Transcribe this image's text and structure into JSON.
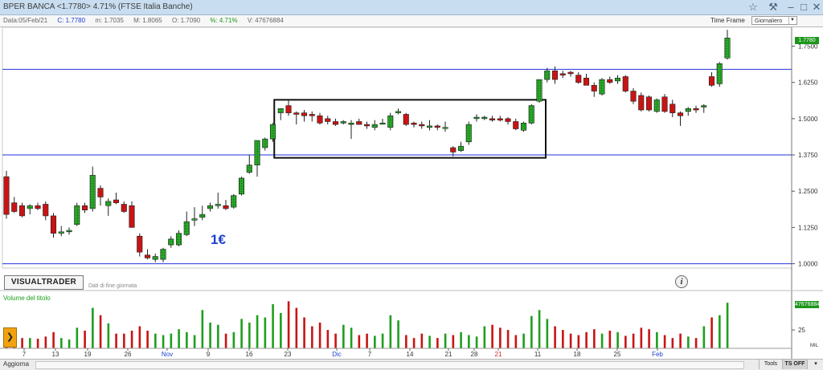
{
  "header": {
    "title": "BPER BANCA  <1.7780>  4.71%    (FTSE Italia Banche)",
    "icons": [
      "star-icon",
      "hammer-icon",
      "minimize-icon",
      "restore-icon",
      "close-icon"
    ]
  },
  "ohlc": {
    "data": "Data:05/Feb/21",
    "c": "C: 1.7780",
    "m": "m: 1.7035",
    "M": "M: 1.8065",
    "o": "O: 1.7090",
    "pct": "%: 4.71%",
    "vol": "V: 47676884"
  },
  "timeframe": {
    "label": "Time Frame",
    "value": "Giornaliero"
  },
  "branding": {
    "logo": "VISUALTRADER",
    "subtitle": "Dati di fine giornata"
  },
  "annotation": "1€",
  "volume_panel": {
    "label": "Volume del titolo",
    "axis_label": "25",
    "unit": "MIL",
    "last_badge": "47676884"
  },
  "price_badge": "1.7780",
  "footer": {
    "aggiorna": "Aggiorna",
    "tools": "Tools",
    "ts_off": "TS OFF"
  },
  "colors": {
    "up": "#1f9e1f",
    "down": "#c81414",
    "level_line": "#2233dd",
    "box": "#111111",
    "month_label": "#1c3fcf",
    "year_label": "#cc2222"
  },
  "chart_data": {
    "type": "candlestick",
    "title": "BPER BANCA",
    "y_axis": {
      "ticks": [
        1.0,
        1.125,
        1.25,
        1.375,
        1.5,
        1.625,
        1.75
      ],
      "tick_labels": [
        "1.0000",
        "1.1250",
        "1.2500",
        "1.3750",
        "1.5000",
        "1.6250",
        "1.7500"
      ],
      "range": [
        0.985,
        1.815
      ]
    },
    "x_labels": [
      "7",
      "13",
      "19",
      "26",
      "Nov",
      "9",
      "16",
      "23",
      "Dic",
      "7",
      "14",
      "21",
      "28",
      "21",
      "11",
      "18",
      "25",
      "Feb"
    ],
    "x_label_types": [
      "day",
      "day",
      "day",
      "day",
      "month",
      "day",
      "day",
      "day",
      "month",
      "day",
      "day",
      "day",
      "day",
      "year",
      "day",
      "day",
      "day",
      "month"
    ],
    "horizontal_levels": [
      1.67,
      1.375,
      1.0
    ],
    "box": {
      "x_from_index": 35,
      "x_to_index": 68,
      "y_low": 1.365,
      "y_high": 1.565
    },
    "volume_ticks": [
      {
        "value": 25,
        "label": "25"
      }
    ],
    "volume_range": [
      0,
      72
    ],
    "candles": [
      {
        "o": 1.3,
        "h": 1.32,
        "l": 1.155,
        "c": 1.17,
        "v": 18
      },
      {
        "o": 1.21,
        "h": 1.23,
        "l": 1.175,
        "c": 1.18,
        "v": 10
      },
      {
        "o": 1.2,
        "h": 1.21,
        "l": 1.16,
        "c": 1.165,
        "v": 14
      },
      {
        "o": 1.19,
        "h": 1.205,
        "l": 1.17,
        "c": 1.2,
        "v": 14
      },
      {
        "o": 1.2,
        "h": 1.21,
        "l": 1.185,
        "c": 1.19,
        "v": 13
      },
      {
        "o": 1.205,
        "h": 1.215,
        "l": 1.15,
        "c": 1.165,
        "v": 16
      },
      {
        "o": 1.165,
        "h": 1.175,
        "l": 1.09,
        "c": 1.105,
        "v": 22
      },
      {
        "o": 1.105,
        "h": 1.13,
        "l": 1.095,
        "c": 1.11,
        "v": 14
      },
      {
        "o": 1.11,
        "h": 1.125,
        "l": 1.1,
        "c": 1.115,
        "v": 12
      },
      {
        "o": 1.135,
        "h": 1.21,
        "l": 1.13,
        "c": 1.2,
        "v": 28
      },
      {
        "o": 1.2,
        "h": 1.21,
        "l": 1.175,
        "c": 1.185,
        "v": 24
      },
      {
        "o": 1.19,
        "h": 1.335,
        "l": 1.18,
        "c": 1.305,
        "v": 55
      },
      {
        "o": 1.26,
        "h": 1.27,
        "l": 1.2,
        "c": 1.23,
        "v": 45
      },
      {
        "o": 1.2,
        "h": 1.225,
        "l": 1.165,
        "c": 1.215,
        "v": 34
      },
      {
        "o": 1.22,
        "h": 1.245,
        "l": 1.205,
        "c": 1.21,
        "v": 20
      },
      {
        "o": 1.205,
        "h": 1.215,
        "l": 1.175,
        "c": 1.18,
        "v": 20
      },
      {
        "o": 1.2,
        "h": 1.215,
        "l": 1.15,
        "c": 1.125,
        "v": 24
      },
      {
        "o": 1.095,
        "h": 1.105,
        "l": 1.025,
        "c": 1.04,
        "v": 30
      },
      {
        "o": 1.03,
        "h": 1.05,
        "l": 1.015,
        "c": 1.02,
        "v": 24
      },
      {
        "o": 1.015,
        "h": 1.035,
        "l": 1.005,
        "c": 1.025,
        "v": 20
      },
      {
        "o": 1.015,
        "h": 1.055,
        "l": 1.005,
        "c": 1.05,
        "v": 18
      },
      {
        "o": 1.065,
        "h": 1.095,
        "l": 1.055,
        "c": 1.085,
        "v": 20
      },
      {
        "o": 1.065,
        "h": 1.115,
        "l": 1.06,
        "c": 1.105,
        "v": 26
      },
      {
        "o": 1.1,
        "h": 1.18,
        "l": 1.095,
        "c": 1.145,
        "v": 22
      },
      {
        "o": 1.15,
        "h": 1.195,
        "l": 1.13,
        "c": 1.155,
        "v": 18
      },
      {
        "o": 1.16,
        "h": 1.2,
        "l": 1.15,
        "c": 1.17,
        "v": 52
      },
      {
        "o": 1.19,
        "h": 1.21,
        "l": 1.18,
        "c": 1.2,
        "v": 35
      },
      {
        "o": 1.2,
        "h": 1.245,
        "l": 1.19,
        "c": 1.205,
        "v": 32
      },
      {
        "o": 1.2,
        "h": 1.22,
        "l": 1.185,
        "c": 1.19,
        "v": 20
      },
      {
        "o": 1.195,
        "h": 1.24,
        "l": 1.19,
        "c": 1.235,
        "v": 22
      },
      {
        "o": 1.24,
        "h": 1.3,
        "l": 1.235,
        "c": 1.295,
        "v": 40
      },
      {
        "o": 1.315,
        "h": 1.375,
        "l": 1.31,
        "c": 1.34,
        "v": 35
      },
      {
        "o": 1.34,
        "h": 1.42,
        "l": 1.3,
        "c": 1.425,
        "v": 45
      },
      {
        "o": 1.4,
        "h": 1.435,
        "l": 1.39,
        "c": 1.43,
        "v": 42
      },
      {
        "o": 1.43,
        "h": 1.485,
        "l": 1.42,
        "c": 1.48,
        "v": 60
      },
      {
        "o": 1.52,
        "h": 1.535,
        "l": 1.495,
        "c": 1.535,
        "v": 48
      },
      {
        "o": 1.545,
        "h": 1.565,
        "l": 1.51,
        "c": 1.52,
        "v": 64
      },
      {
        "o": 1.52,
        "h": 1.525,
        "l": 1.48,
        "c": 1.515,
        "v": 55
      },
      {
        "o": 1.52,
        "h": 1.53,
        "l": 1.49,
        "c": 1.51,
        "v": 42
      },
      {
        "o": 1.515,
        "h": 1.525,
        "l": 1.49,
        "c": 1.51,
        "v": 30
      },
      {
        "o": 1.51,
        "h": 1.52,
        "l": 1.48,
        "c": 1.485,
        "v": 35
      },
      {
        "o": 1.5,
        "h": 1.51,
        "l": 1.48,
        "c": 1.49,
        "v": 25
      },
      {
        "o": 1.49,
        "h": 1.5,
        "l": 1.475,
        "c": 1.48,
        "v": 20
      },
      {
        "o": 1.485,
        "h": 1.495,
        "l": 1.48,
        "c": 1.49,
        "v": 32
      },
      {
        "o": 1.48,
        "h": 1.495,
        "l": 1.43,
        "c": 1.485,
        "v": 28
      },
      {
        "o": 1.49,
        "h": 1.5,
        "l": 1.48,
        "c": 1.48,
        "v": 18
      },
      {
        "o": 1.48,
        "h": 1.49,
        "l": 1.465,
        "c": 1.475,
        "v": 20
      },
      {
        "o": 1.47,
        "h": 1.495,
        "l": 1.46,
        "c": 1.48,
        "v": 17
      },
      {
        "o": 1.485,
        "h": 1.5,
        "l": 1.48,
        "c": 1.485,
        "v": 20
      },
      {
        "o": 1.47,
        "h": 1.52,
        "l": 1.46,
        "c": 1.51,
        "v": 45
      },
      {
        "o": 1.52,
        "h": 1.535,
        "l": 1.515,
        "c": 1.525,
        "v": 38
      },
      {
        "o": 1.515,
        "h": 1.52,
        "l": 1.475,
        "c": 1.48,
        "v": 18
      },
      {
        "o": 1.485,
        "h": 1.49,
        "l": 1.47,
        "c": 1.48,
        "v": 14
      },
      {
        "o": 1.48,
        "h": 1.49,
        "l": 1.465,
        "c": 1.475,
        "v": 20
      },
      {
        "o": 1.47,
        "h": 1.495,
        "l": 1.46,
        "c": 1.475,
        "v": 17
      },
      {
        "o": 1.475,
        "h": 1.48,
        "l": 1.46,
        "c": 1.47,
        "v": 14
      },
      {
        "o": 1.47,
        "h": 1.49,
        "l": 1.455,
        "c": 1.47,
        "v": 20
      },
      {
        "o": 1.4,
        "h": 1.405,
        "l": 1.37,
        "c": 1.385,
        "v": 18
      },
      {
        "o": 1.39,
        "h": 1.42,
        "l": 1.385,
        "c": 1.405,
        "v": 22
      },
      {
        "o": 1.42,
        "h": 1.49,
        "l": 1.41,
        "c": 1.48,
        "v": 18
      },
      {
        "o": 1.5,
        "h": 1.515,
        "l": 1.49,
        "c": 1.505,
        "v": 16
      },
      {
        "o": 1.5,
        "h": 1.51,
        "l": 1.495,
        "c": 1.505,
        "v": 30
      },
      {
        "o": 1.5,
        "h": 1.51,
        "l": 1.49,
        "c": 1.495,
        "v": 32
      },
      {
        "o": 1.5,
        "h": 1.51,
        "l": 1.49,
        "c": 1.495,
        "v": 28
      },
      {
        "o": 1.5,
        "h": 1.505,
        "l": 1.48,
        "c": 1.49,
        "v": 25
      },
      {
        "o": 1.49,
        "h": 1.5,
        "l": 1.46,
        "c": 1.465,
        "v": 18
      },
      {
        "o": 1.46,
        "h": 1.49,
        "l": 1.455,
        "c": 1.485,
        "v": 20
      },
      {
        "o": 1.485,
        "h": 1.55,
        "l": 1.48,
        "c": 1.545,
        "v": 44
      },
      {
        "o": 1.56,
        "h": 1.635,
        "l": 1.555,
        "c": 1.635,
        "v": 52
      },
      {
        "o": 1.635,
        "h": 1.675,
        "l": 1.625,
        "c": 1.665,
        "v": 40
      },
      {
        "o": 1.665,
        "h": 1.68,
        "l": 1.62,
        "c": 1.635,
        "v": 30
      },
      {
        "o": 1.655,
        "h": 1.665,
        "l": 1.64,
        "c": 1.65,
        "v": 25
      },
      {
        "o": 1.66,
        "h": 1.665,
        "l": 1.645,
        "c": 1.655,
        "v": 20
      },
      {
        "o": 1.65,
        "h": 1.66,
        "l": 1.62,
        "c": 1.625,
        "v": 18
      },
      {
        "o": 1.64,
        "h": 1.655,
        "l": 1.615,
        "c": 1.615,
        "v": 22
      },
      {
        "o": 1.615,
        "h": 1.625,
        "l": 1.575,
        "c": 1.595,
        "v": 26
      },
      {
        "o": 1.585,
        "h": 1.64,
        "l": 1.58,
        "c": 1.635,
        "v": 20
      },
      {
        "o": 1.635,
        "h": 1.645,
        "l": 1.62,
        "c": 1.625,
        "v": 24
      },
      {
        "o": 1.63,
        "h": 1.65,
        "l": 1.62,
        "c": 1.64,
        "v": 22
      },
      {
        "o": 1.645,
        "h": 1.65,
        "l": 1.59,
        "c": 1.595,
        "v": 17
      },
      {
        "o": 1.595,
        "h": 1.605,
        "l": 1.55,
        "c": 1.56,
        "v": 20
      },
      {
        "o": 1.58,
        "h": 1.59,
        "l": 1.525,
        "c": 1.53,
        "v": 28
      },
      {
        "o": 1.575,
        "h": 1.58,
        "l": 1.525,
        "c": 1.53,
        "v": 26
      },
      {
        "o": 1.525,
        "h": 1.57,
        "l": 1.52,
        "c": 1.565,
        "v": 22
      },
      {
        "o": 1.575,
        "h": 1.585,
        "l": 1.52,
        "c": 1.525,
        "v": 18
      },
      {
        "o": 1.55,
        "h": 1.565,
        "l": 1.505,
        "c": 1.52,
        "v": 14
      },
      {
        "o": 1.52,
        "h": 1.525,
        "l": 1.475,
        "c": 1.51,
        "v": 20
      },
      {
        "o": 1.525,
        "h": 1.54,
        "l": 1.51,
        "c": 1.535,
        "v": 16
      },
      {
        "o": 1.535,
        "h": 1.545,
        "l": 1.52,
        "c": 1.53,
        "v": 14
      },
      {
        "o": 1.54,
        "h": 1.55,
        "l": 1.52,
        "c": 1.545,
        "v": 30
      },
      {
        "o": 1.645,
        "h": 1.66,
        "l": 1.61,
        "c": 1.615,
        "v": 42
      },
      {
        "o": 1.62,
        "h": 1.695,
        "l": 1.61,
        "c": 1.69,
        "v": 45
      },
      {
        "o": 1.709,
        "h": 1.8065,
        "l": 1.7035,
        "c": 1.778,
        "v": 62
      }
    ]
  }
}
